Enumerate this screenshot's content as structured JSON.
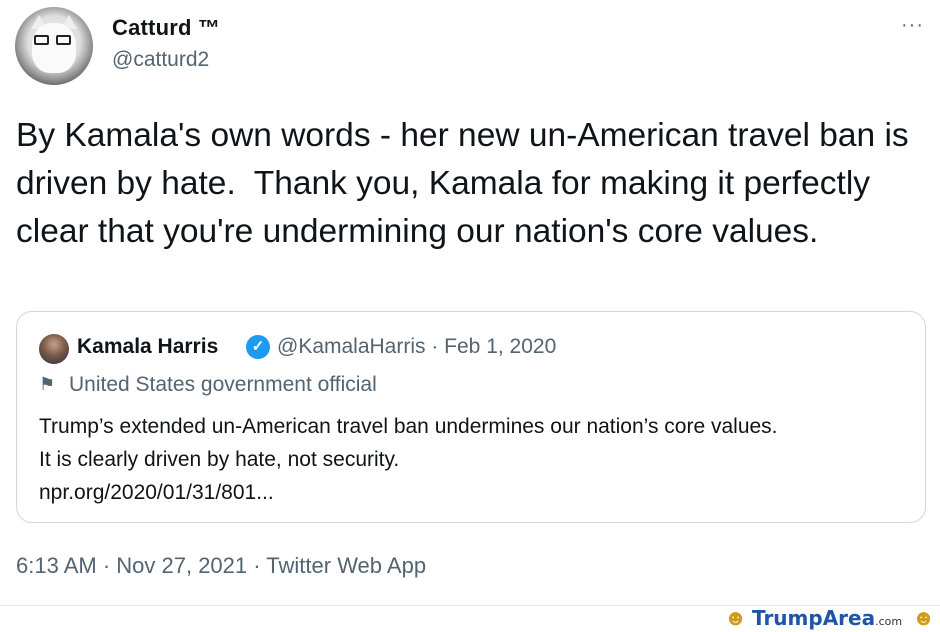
{
  "author": {
    "name": "Catturd ™",
    "handle": "@catturd2"
  },
  "menu": {
    "more_label": "···"
  },
  "tweet_text": "By Kamala's own words - her new un-American travel ban is driven by hate.  Thank you, Kamala for making it perfectly clear that you're undermining our nation's core values.",
  "quoted": {
    "name": "Kamala Harris",
    "verified_mark": "✓",
    "meta": "@KamalaHarris · Feb 1, 2020",
    "label_icon": "flag-icon",
    "label": "United States government official",
    "text_line1": "Trump’s extended un-American travel ban undermines our nation’s core values.",
    "text_line2": "It is clearly driven by hate, not security.",
    "link": "npr.org/2020/01/31/801..."
  },
  "timestamp": "6:13 AM · Nov 27, 2021 · Twitter Web App",
  "watermark": {
    "brand": "TrumpArea",
    "suffix": ".com",
    "accent_color": "#1f55a8"
  }
}
